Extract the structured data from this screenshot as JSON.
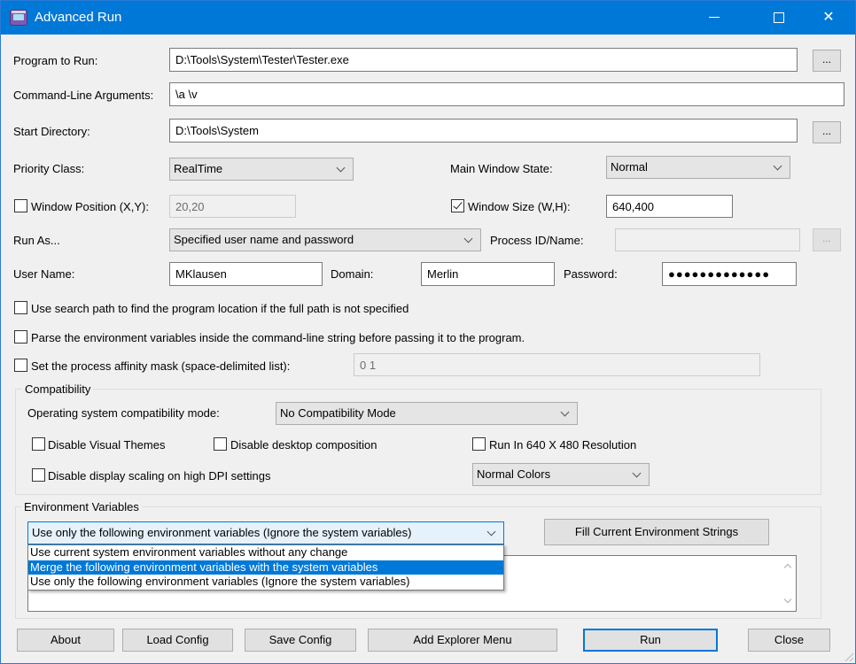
{
  "window": {
    "title": "Advanced Run",
    "controls": {
      "minimize": "minimize",
      "maximize": "maximize",
      "close": "close"
    }
  },
  "program": {
    "label": "Program to Run:",
    "value": "D:\\Tools\\System\\Tester\\Tester.exe",
    "browse_label": "..."
  },
  "arguments": {
    "label": "Command-Line Arguments:",
    "value": "\\a \\v"
  },
  "start_dir": {
    "label": "Start Directory:",
    "value": "D:\\Tools\\System",
    "browse_label": "..."
  },
  "priority": {
    "label": "Priority Class:",
    "value": "RealTime"
  },
  "window_state": {
    "label": "Main Window State:",
    "value": "Normal"
  },
  "window_position": {
    "label": "Window Position (X,Y):",
    "checked": false,
    "value": "20,20"
  },
  "window_size": {
    "label": "Window Size (W,H):",
    "checked": true,
    "value": "640,400"
  },
  "run_as": {
    "label": "Run As...",
    "value": "Specified user name and password"
  },
  "process": {
    "label": "Process ID/Name:",
    "value": "",
    "browse_label": "..."
  },
  "credentials": {
    "user_label": "User Name:",
    "user_value": "MKlausen",
    "domain_label": "Domain:",
    "domain_value": "Merlin",
    "password_label": "Password:",
    "password_value": "●●●●●●●●●●●●●"
  },
  "options": [
    {
      "label": "Use search path to find the program location if the full path is not specified",
      "checked": false
    },
    {
      "label": "Parse the environment variables inside the command-line string before passing it to the program.",
      "checked": false
    },
    {
      "label": "Set the process affinity mask (space-delimited list):",
      "checked": false
    }
  ],
  "affinity_value": "0 1",
  "compatibility": {
    "group_title": "Compatibility",
    "os_mode_label": "Operating system compatibility mode:",
    "os_mode_value": "No Compatibility Mode",
    "disable_themes": {
      "label": "Disable Visual Themes",
      "checked": false
    },
    "disable_composition": {
      "label": "Disable desktop composition",
      "checked": false
    },
    "run_640": {
      "label": "Run In 640 X 480 Resolution",
      "checked": false
    },
    "disable_dpi": {
      "label": "Disable display scaling on high DPI settings",
      "checked": false
    },
    "colors_value": "Normal Colors"
  },
  "environment": {
    "group_title": "Environment Variables",
    "mode_value": "Use only the following environment variables (Ignore the  system variables)",
    "mode_options": [
      "Use current system environment variables without any change",
      "Merge the following environment variables with the system variables",
      "Use only the following environment variables (Ignore the  system variables)"
    ],
    "highlighted_option": 1,
    "fill_button": "Fill Current Environment Strings",
    "strings_value": ""
  },
  "footer": {
    "about": "About",
    "load_config": "Load Config",
    "save_config": "Save Config",
    "add_explorer_menu": "Add Explorer Menu",
    "run": "Run",
    "close": "Close"
  },
  "colors": {
    "titlebar": "#0078d7",
    "selection": "#0078d7",
    "dialog_bg": "#f0f0f0"
  }
}
